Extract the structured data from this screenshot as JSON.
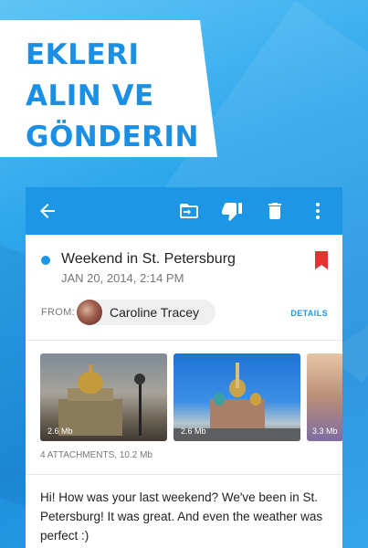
{
  "banner": {
    "line1": "EKLERI",
    "line2": "ALIN VE",
    "line3": "GÖNDERIN"
  },
  "toolbar": {
    "icons": [
      "back-arrow-icon",
      "move-to-folder-icon",
      "spam-icon",
      "trash-icon",
      "more-vert-icon"
    ]
  },
  "email": {
    "subject": "Weekend in St. Petersburg",
    "date": "JAN 20, 2014, 2:14 PM",
    "from_label": "FROM:",
    "sender": "Caroline Tracey",
    "details_label": "DETAILS"
  },
  "attachments": {
    "items": [
      {
        "size": "2.6 Mb"
      },
      {
        "size": "2.6 Mb"
      },
      {
        "size": "3.3 Mb"
      }
    ],
    "summary": "4 ATTACHMENTS, 10.2 Mb"
  },
  "body": {
    "text": "Hi! How was your last weekend? We've been in St. Petersburg! It was great. And even the weather was perfect :)"
  },
  "colors": {
    "accent": "#1d96e6",
    "bookmark": "#e8322f",
    "banner_text": "#1a8fe3"
  }
}
